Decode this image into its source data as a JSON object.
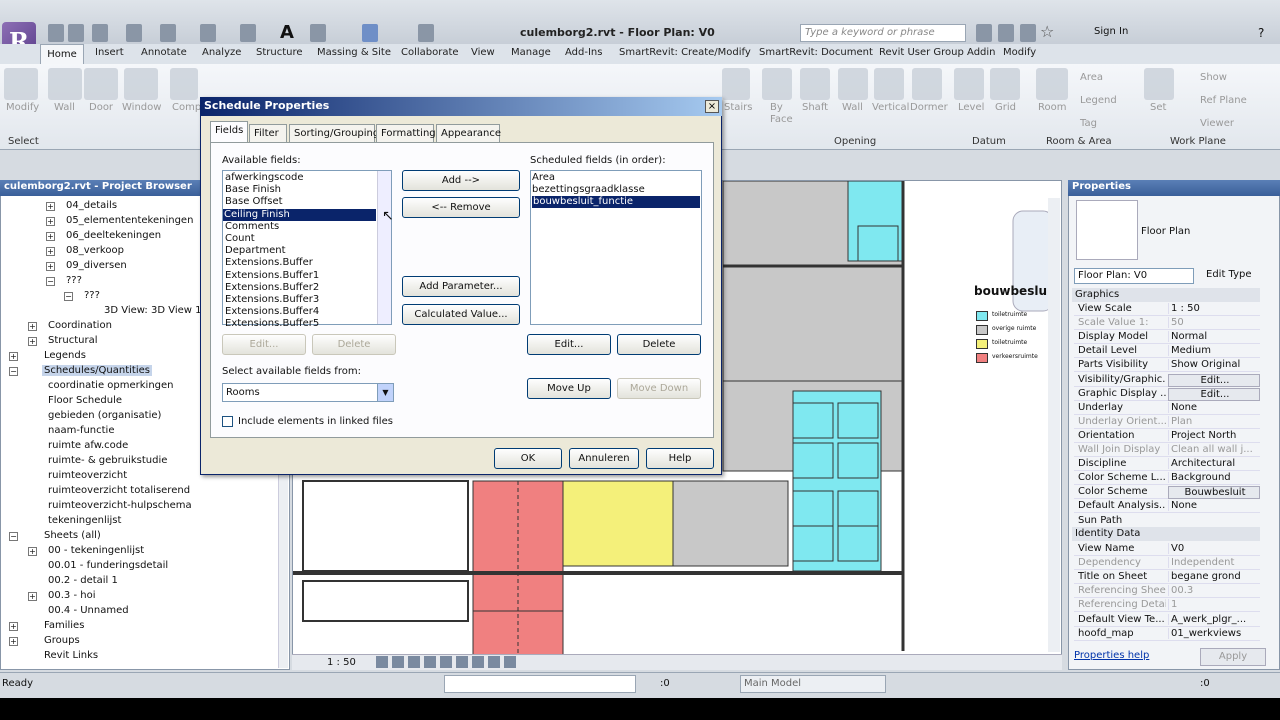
{
  "app": {
    "title": "culemborg2.rvt - Floor Plan: V0",
    "search_placeholder": "Type a keyword or phrase",
    "sign_in": "Sign In"
  },
  "ribbon_tabs": [
    "Home",
    "Insert",
    "Annotate",
    "Analyze",
    "Structure",
    "Massing & Site",
    "Collaborate",
    "View",
    "Manage",
    "Add-Ins",
    "SmartRevit: Create/Modify",
    "SmartRevit: Document",
    "Revit User Group Addin",
    "Modify"
  ],
  "ribbon": {
    "buttons": [
      "Modify",
      "Wall",
      "Door",
      "Window",
      "Comp",
      "Stairs",
      "By Face",
      "Shaft",
      "Wall",
      "Vertical",
      "Dormer",
      "Level",
      "Grid",
      "Room",
      "Set"
    ],
    "small": [
      "Area",
      "Legend",
      "Tag",
      "Show",
      "Ref Plane",
      "Viewer"
    ],
    "groups": [
      "Select",
      "Opening",
      "Datum",
      "Room & Area",
      "Work Plane"
    ]
  },
  "browser": {
    "title": "culemborg2.rvt - Project Browser",
    "items": [
      "04_details",
      "05_elemententekeningen",
      "06_deeltekeningen",
      "08_verkoop",
      "09_diversen",
      "???",
      "???",
      "3D View: 3D View 1",
      "Coordination",
      "Structural",
      "Legends",
      "Schedules/Quantities",
      "coordinatie opmerkingen",
      "Floor Schedule",
      "gebieden (organisatie)",
      "naam-functie",
      "ruimte afw.code",
      "ruimte- & gebruikstudie",
      "ruimteoverzicht",
      "ruimteoverzicht totaliserend",
      "ruimteoverzicht-hulpschema",
      "tekeningenlijst",
      "Sheets (all)",
      "00 - tekeningenlijst",
      "00.01 - funderingsdetail",
      "00.2 - detail 1",
      "00.3 - hoi",
      "00.4 - Unnamed",
      "Families",
      "Groups",
      "Revit Links"
    ]
  },
  "canvas": {
    "legend_title": "bouwbesluit",
    "legend_items": [
      "toiletruimte",
      "overige ruimte",
      "toiletruimte",
      "verkeersruimte"
    ],
    "legend_colors": [
      "#7fe8f0",
      "#c8c8c8",
      "#f4f07a",
      "#f08080"
    ],
    "scale": "1 : 50"
  },
  "properties": {
    "title": "Properties",
    "type": "Floor Plan",
    "instance": "Floor Plan: V0",
    "edit_type": "Edit Type",
    "groups": [
      "Graphics",
      "Identity Data"
    ],
    "rows": [
      [
        "View Scale",
        "1 : 50"
      ],
      [
        "Scale Value    1:",
        "50"
      ],
      [
        "Display Model",
        "Normal"
      ],
      [
        "Detail Level",
        "Medium"
      ],
      [
        "Parts Visibility",
        "Show Original"
      ],
      [
        "Visibility/Graphic...",
        "Edit..."
      ],
      [
        "Graphic Display ...",
        "Edit..."
      ],
      [
        "Underlay",
        "None"
      ],
      [
        "Underlay Orient...",
        "Plan"
      ],
      [
        "Orientation",
        "Project North"
      ],
      [
        "Wall Join Display",
        "Clean all wall j..."
      ],
      [
        "Discipline",
        "Architectural"
      ],
      [
        "Color Scheme L...",
        "Background"
      ],
      [
        "Color Scheme",
        "Bouwbesluit"
      ],
      [
        "Default Analysis...",
        "None"
      ],
      [
        "Sun Path",
        ""
      ]
    ],
    "identity": [
      [
        "View Name",
        "V0"
      ],
      [
        "Dependency",
        "Independent"
      ],
      [
        "Title on Sheet",
        "begane grond"
      ],
      [
        "Referencing Sheet",
        "00.3"
      ],
      [
        "Referencing Detail",
        "1"
      ],
      [
        "Default View Te...",
        "A_werk_plgr_..."
      ],
      [
        "hoofd_map",
        "01_werkviews"
      ]
    ],
    "help": "Properties help",
    "apply": "Apply"
  },
  "status": {
    "ready": "Ready",
    "zero": ":0",
    "model": "Main Model",
    "filter": ":0"
  },
  "dialog": {
    "title": "Schedule Properties",
    "tabs": [
      "Fields",
      "Filter",
      "Sorting/Grouping",
      "Formatting",
      "Appearance"
    ],
    "available_label": "Available fields:",
    "scheduled_label": "Scheduled fields (in order):",
    "available": [
      "afwerkingscode",
      "Base Finish",
      "Base Offset",
      "Ceiling Finish",
      "Comments",
      "Count",
      "Department",
      "Extensions.Buffer",
      "Extensions.Buffer1",
      "Extensions.Buffer2",
      "Extensions.Buffer3",
      "Extensions.Buffer4",
      "Extensions.Buffer5"
    ],
    "scheduled": [
      "Area",
      "bezettingsgraadklasse",
      "bouwbesluit_functie"
    ],
    "add": "Add -->",
    "remove": "<-- Remove",
    "add_param": "Add Parameter...",
    "calc": "Calculated Value...",
    "edit": "Edit...",
    "delete": "Delete",
    "edit2": "Edit...",
    "delete2": "Delete",
    "move_up": "Move Up",
    "move_down": "Move Down",
    "select_from_label": "Select available fields from:",
    "select_from": "Rooms",
    "include_linked": "Include elements in linked files",
    "ok": "OK",
    "cancel": "Annuleren",
    "help": "Help"
  }
}
